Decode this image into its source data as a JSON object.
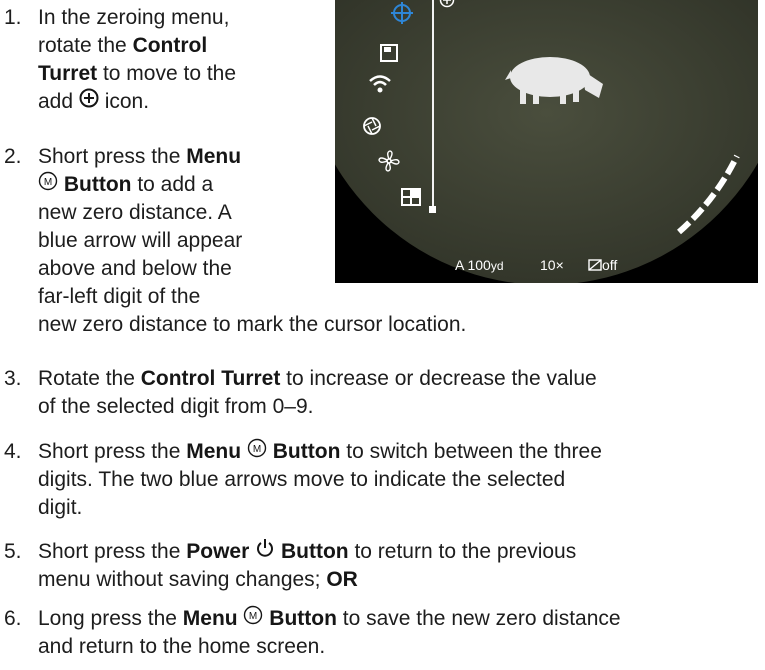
{
  "steps": [
    {
      "num": "1.",
      "lines": [
        [
          "In the zeroing menu,"
        ],
        [
          "rotate the ",
          {
            "b": "Control"
          }
        ],
        [
          {
            "b": "Turret"
          },
          " to move to the"
        ],
        [
          "add ",
          {
            "icon": "add-circle-icon"
          },
          " icon."
        ]
      ]
    },
    {
      "num": "2.",
      "lines": [
        [
          "Short press the ",
          {
            "b": "Menu"
          }
        ],
        [
          {
            "icon": "menu-m-icon"
          },
          " ",
          {
            "b": "Button"
          },
          " to add a"
        ],
        [
          "new zero distance. A"
        ],
        [
          "blue arrow will appear"
        ],
        [
          "above and below the"
        ],
        [
          "far-left digit of the"
        ],
        [
          "new zero distance to mark the cursor location."
        ]
      ]
    },
    {
      "num": "3.",
      "lines": [
        [
          "Rotate the ",
          {
            "b": "Control Turret"
          },
          " to increase or decrease the value"
        ],
        [
          "of the selected digit from 0–9."
        ]
      ]
    },
    {
      "num": "4.",
      "lines": [
        [
          "Short press the ",
          {
            "b": "Menu"
          },
          " ",
          {
            "icon": "menu-m-icon"
          },
          " ",
          {
            "b": "Button"
          },
          " to switch between the three"
        ],
        [
          "digits. The two blue arrows move to indicate the selected"
        ],
        [
          "digit."
        ]
      ]
    },
    {
      "num": "5.",
      "lines": [
        [
          "Short press the ",
          {
            "b": "Power"
          },
          " ",
          {
            "icon": "power-icon"
          },
          " ",
          {
            "b": "Button"
          },
          " to return to the previous"
        ],
        [
          "menu without saving changes; ",
          {
            "b": "OR"
          }
        ]
      ]
    },
    {
      "num": "6.",
      "lines": [
        [
          "Long press the ",
          {
            "b": "Menu"
          },
          " ",
          {
            "icon": "menu-m-icon"
          },
          " ",
          {
            "b": "Button"
          },
          " to save the new zero distance"
        ],
        [
          "and return to the home screen."
        ]
      ]
    }
  ],
  "scope": {
    "status_mode": "A",
    "status_distance_value": "100",
    "status_distance_unit": "yd",
    "status_zoom": "10×",
    "status_pip": "off",
    "menu_icons": [
      "crosshair-icon",
      "save-icon",
      "wifi-icon",
      "aperture-icon",
      "fan-icon",
      "grid-icon"
    ],
    "add_icon": "add-circle-icon",
    "accent_color": "#2e86d6",
    "background_color": "#414536"
  }
}
